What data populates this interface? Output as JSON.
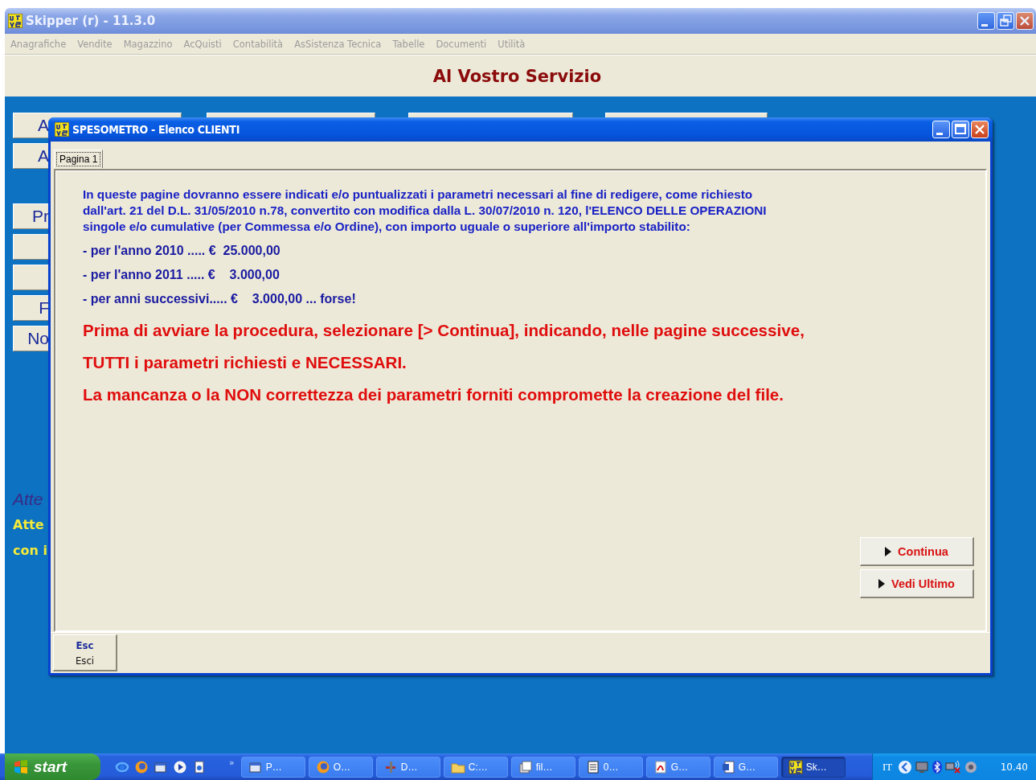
{
  "window": {
    "title": "Skipper (r) - 11.3.0"
  },
  "menu": [
    {
      "label": "Anagrafiche",
      "disabled": true
    },
    {
      "label": "Vendite",
      "disabled": true
    },
    {
      "label": "Magazzino",
      "disabled": true
    },
    {
      "label": "AcQuisti",
      "disabled": true
    },
    {
      "label": "Contabilità",
      "disabled": true
    },
    {
      "label": "AsSistenza Tecnica",
      "disabled": true
    },
    {
      "label": "Tabelle",
      "disabled": true
    },
    {
      "label": "Documenti",
      "disabled": true
    },
    {
      "label": "Utilità",
      "disabled": true
    }
  ],
  "header": {
    "title": "Al Vostro Servizio"
  },
  "left_buttons": [
    {
      "kind": "text",
      "label": "A"
    },
    {
      "kind": "text",
      "label": "A"
    },
    {
      "kind": "text",
      "label": "Pr"
    },
    {
      "kind": "blank"
    },
    {
      "kind": "blank"
    },
    {
      "kind": "text",
      "label": "F"
    },
    {
      "kind": "text",
      "label": "No"
    }
  ],
  "notes": [
    {
      "kind": "italic",
      "text": "Atte"
    },
    {
      "kind": "warning",
      "text": "Atte"
    },
    {
      "kind": "warning",
      "text": "con i"
    }
  ],
  "dialog": {
    "title": "SPESOMETRO - Elenco CLIENTI",
    "tabs": [
      {
        "label": "Pagina 1",
        "selected": true
      }
    ],
    "intro": "In queste pagine dovranno essere indicati e/o puntualizzati i parametri necessari al fine di redigere, come richiesto\ndall'art. 21 del D.L. 31/05/2010 n.78, convertito con modifica dalla L. 30/07/2010 n. 120, l'ELENCO DELLE OPERAZIONI\nsingole e/o cumulative (per Commessa e/o Ordine), con importo uguale o superiore all'importo stabilito:",
    "amounts": [
      "- per l'anno 2010 ..... €  25.000,00",
      "- per l'anno 2011 ..... €    3.000,00",
      "- per anni successivi..... €    3.000,00 ... forse!"
    ],
    "warnings": [
      "Prima di avviare la procedura, selezionare [> Continua], indicando, nelle pagine successive,",
      "TUTTI i parametri richiesti e NECESSARI.",
      "La mancanza o la NON correttezza dei parametri forniti compromette la creazione del file."
    ],
    "buttons": [
      "Continua",
      "Vedi Ultimo"
    ],
    "footer_button": {
      "key": "Esc",
      "label": "Esci"
    }
  },
  "taskbar": {
    "start": "start",
    "more": "»",
    "tasks": [
      {
        "label": "P…",
        "selected": false
      },
      {
        "label": "O…",
        "selected": false
      },
      {
        "label": "D…",
        "selected": false
      },
      {
        "label": "C:…",
        "selected": false
      },
      {
        "label": "fil…",
        "selected": false
      },
      {
        "label": "0…",
        "selected": false
      },
      {
        "label": "G…",
        "selected": false
      },
      {
        "label": "G…",
        "selected": false
      },
      {
        "label": "Sk…",
        "selected": true
      }
    ],
    "language": "IT",
    "clock": "10.40"
  }
}
